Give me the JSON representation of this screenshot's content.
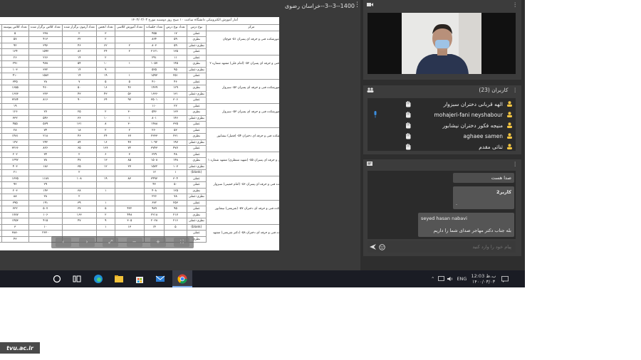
{
  "document": {
    "tab_title": "1400--3--3--خراسان رضوی",
    "report_title": "آمار آموزش الکترونیکی دانشگاه ساعت ۱۰ صبح روز دوشنبه مورخ ۱۴۰۳/۰۳/۰۳",
    "columns": [
      "تعداد",
      "تعداد کلاس پیوسته",
      "تعداد کلاس برگزار شده",
      "تعداد آزمون برگزار شده",
      "تعداد انجمن",
      "تعداد آموزش کلاسی",
      "تعداد جلسات",
      "تعداد نوع درس",
      "نوع درس",
      "مرکز",
      "استان"
    ],
    "province": "خراسان رضوی",
    "centers": [
      "آموزشکده فنی و حرفه ای پسران ۵۱- قوچان",
      "آموزشکده فنی و حرفه ای پسران ۵۲- (امام علی) مشهد شماره ۲",
      "آموزشکده فنی و حرفه ای پسران ۵۳- سبزوار",
      "آموزشکده فنی و حرفه ای دختران ۵۴- (فضل) نیشابور",
      "دانشکده فنی و حرفه ای پسران ۵۵- (شهید منتظری) مشهد شماره ۱",
      "آموزشکده فنی و حرفه ای پسران ۵۶- (امام خمینی) سبزوار",
      "آموزشکده فنی و حرفه ای دختران ۵۷- (شریعتی) نیشابور",
      "آموزشکده فنی و حرفه ای دختران ۵۸- (دکتر شریعتی) مشهد"
    ],
    "course_types": [
      "عملی",
      "نظری",
      "نظری-عملی",
      "(blank)"
    ],
    "rows": [
      [
        "۲",
        "۵",
        "۳۳۸",
        "۲",
        "۳",
        "",
        "۴۵۵",
        "۱۷",
        "عملی"
      ],
      [
        "۱",
        "۵۷",
        "۴۱۳",
        "۳۲",
        "۲",
        "",
        "۸۶۴",
        "۵۹",
        "نظری"
      ],
      [
        "۸",
        "۹۲",
        "۳۹۶",
        "۴۶",
        "۶۲",
        "۲",
        "۸۰۳",
        "۵۹",
        "نظری-عملی"
      ],
      [
        "۸",
        "۱۳۴",
        "۱۵۹۲",
        "۸۶",
        "۲۴",
        "۲",
        "۲۱۲۱",
        "۱۳۵",
        "عملی"
      ],
      [
        "۱",
        "۲۶",
        "۲۶۶",
        "۱۴",
        "۲",
        "",
        "۲۹۱",
        "۱۱",
        "عملی"
      ],
      [
        "۹",
        "۲۹۱",
        "۹۷۸",
        "۵۴",
        "۱۰",
        "۱",
        "۱۰۵۷",
        "۱۴۵",
        "نظری"
      ],
      [
        "۵",
        "۱۰۳",
        "۳۳۲",
        "۱۴",
        "۹",
        "",
        "۵۲۵",
        "۹۵",
        "نظری-عملی"
      ],
      [
        "۷",
        "۴۱۰",
        "۱۵۸۲",
        "۱۴",
        "۱۹",
        "۱",
        "۱۵۹۳",
        "۲۵۱",
        "عملی"
      ],
      [
        "۵",
        "۳۴۵",
        "۲۸",
        "۷",
        "۵",
        "۵",
        "۴۱۰",
        "۴۶",
        "عملی"
      ],
      [
        "۵",
        "۱۶۵۵",
        "۴۶۰",
        "۵۰",
        "۱۶",
        "۴۶",
        "۱۴۳۹",
        "۱۲۹",
        "نظری"
      ],
      [
        "۸",
        "۱۶۷۳",
        "۳۲۳",
        "۴۳",
        "۴۳",
        "۵۶",
        "۱۶۳۶",
        "۱۳۱",
        "نظری-عملی"
      ],
      [
        "۲",
        "۳۲۸۴",
        "۸۱۶",
        "۹۰",
        "۶۴",
        "۹۷",
        "۳۵۰۱",
        "۳۰۶",
        "عملی"
      ],
      [
        "۱",
        "۱۹",
        "",
        "",
        "",
        "",
        "۱۱۰",
        "۲۲",
        "عملی"
      ],
      [
        "۶",
        "۱۲۶",
        "۲۷",
        "۲۵",
        "۲",
        "۳۰",
        "۵۴۶",
        "۱۳۳",
        "نظری"
      ],
      [
        "۲",
        "۳۳۲",
        "۵۴۶",
        "۳۶",
        "۱۰",
        "۱",
        "۸۰۱",
        "۱۴۶",
        "نظری-عملی"
      ],
      [
        "۹",
        "۴۵۵",
        "۵۷۹",
        "۱۳۱",
        "۸",
        "۳۰",
        "۱۴۸۸",
        "۳۳۵",
        "عملی"
      ],
      [
        "۲",
        "۲۸",
        "۷۴",
        "۱۸",
        "۲",
        "۲",
        "۲۶۰",
        "۵۲",
        "عملی"
      ],
      [
        "۷",
        "۱۴۸۱",
        "۲۱۸",
        "۴۶",
        "۲۴",
        "۶۷",
        "۲۳۳۳",
        "۲۳۱",
        "نظری"
      ],
      [
        "۷",
        "۱۴۷",
        "۲۴۲",
        "۸۴",
        "۱۶",
        "۴۷",
        "۱۰۹۲",
        "۱۹۷",
        "نظری-عملی"
      ],
      [
        "۸",
        "۳۲۶۶",
        "۸۲۶",
        "۶۵",
        "۱۳۶",
        "۷۲",
        "۳۷۴۳",
        "۴۷۷",
        "عملی"
      ],
      [
        "۲",
        "۲۰۲",
        "۳۴",
        "۲",
        "۶",
        "۳",
        "۳۲۹",
        "۴۸",
        "عملی"
      ],
      [
        "۲",
        "۱۲۹۲",
        "۷۸",
        "۴۷",
        "۱۳",
        "۸۵",
        "۱۵۰۸",
        "۱۴۸",
        "نظری"
      ],
      [
        "۵",
        "۴۰۳",
        "۱۸۶",
        "۳۵",
        "۱۲",
        "۲۷",
        "۱۵۷۲",
        "۱۰۷",
        "نظری-عملی"
      ],
      [
        "",
        "۲۱",
        "",
        "۲",
        "",
        "",
        "۱۲",
        "۱",
        "(blank)"
      ],
      [
        "۸",
        "۱۳۳۵",
        "۱۱۸۷",
        "۱۰۸",
        "۱۹",
        "۸۳",
        "۳۴۹۳",
        "۳۰۴",
        "عملی"
      ],
      [
        "۲",
        "۹۲",
        "۲۹",
        "",
        "",
        "",
        "۴۳",
        "۵۰",
        "عملی"
      ],
      [
        "۵",
        "۲۰۳",
        "۱۴۳",
        "۳۸",
        "۱",
        "",
        "۴۰۸",
        "۱۲۵",
        "نظری"
      ],
      [
        "۲",
        "۸۸",
        "۲۸",
        "۲",
        "",
        "",
        "۲۲۶",
        "۷۸",
        "نظری-عملی"
      ],
      [
        "۹",
        "۳۹۵",
        "۱۹۱",
        "۳۹",
        "۱",
        "",
        "۶۷۲",
        "۲۵۳",
        "عملی"
      ],
      [
        "۳",
        "۳۳۲",
        "۵۰۷",
        "۳۷",
        "۵",
        "۴۳۲",
        "۹۸۹",
        "۹۵",
        "عملی"
      ],
      [
        "۲",
        "۱۷۷۷",
        "۱۰۶",
        "۱۶۳",
        "۲",
        "۴۴۸",
        "۲۲۱۸",
        "۲۱۷",
        "نظری"
      ],
      [
        "۳",
        "۱۴۵۳",
        "۴۱۵",
        "۴۷",
        "۹",
        "۳۰۵",
        "۲۰۲۸",
        "۲۱۶",
        "نظری-عملی"
      ],
      [
        "",
        "۳",
        "۱۰",
        "",
        "۱",
        "۱۳",
        "۱۴",
        "۵",
        "(blank)"
      ],
      [
        "۵",
        "۳۸۸۰",
        "۲۳۳۰",
        "",
        "",
        "",
        "",
        "",
        "عملی"
      ],
      [
        "۱",
        "۴۳",
        "",
        "",
        "",
        "",
        "",
        "",
        "نظری"
      ]
    ]
  },
  "video_panel": {
    "title": ""
  },
  "users_panel": {
    "title": "کاربران (23)",
    "users": [
      {
        "name": "الهه قربانی دختران سبزوار",
        "mic": false
      },
      {
        "name": "mohajeri-fani neyshabour",
        "mic": true
      },
      {
        "name": "منیجه فکور دختران نیشابور",
        "mic": false
      },
      {
        "name": "aghaee samen",
        "mic": false
      },
      {
        "name": "ثنائی مقدم",
        "mic": false
      }
    ]
  },
  "chat_panel": {
    "messages": [
      {
        "sender": "",
        "text": "صدا هست"
      },
      {
        "sender": "کاربر2",
        "text": "."
      },
      {
        "sender": "seyed hasan nabavi",
        "text": "بله جناب دکتر مهاجر صدای شما را داریم"
      }
    ],
    "input_placeholder": "پیام خود را وارد کنید"
  },
  "taskbar": {
    "lang": "ENG",
    "time": "12:03 ب.ظ",
    "date": "۱۴۰۰/۰۳/۰۳"
  },
  "colors": {
    "user_icon": "#f4c542",
    "mic": "#3b8ee0"
  },
  "logo_text": "tvu.ac.ir"
}
